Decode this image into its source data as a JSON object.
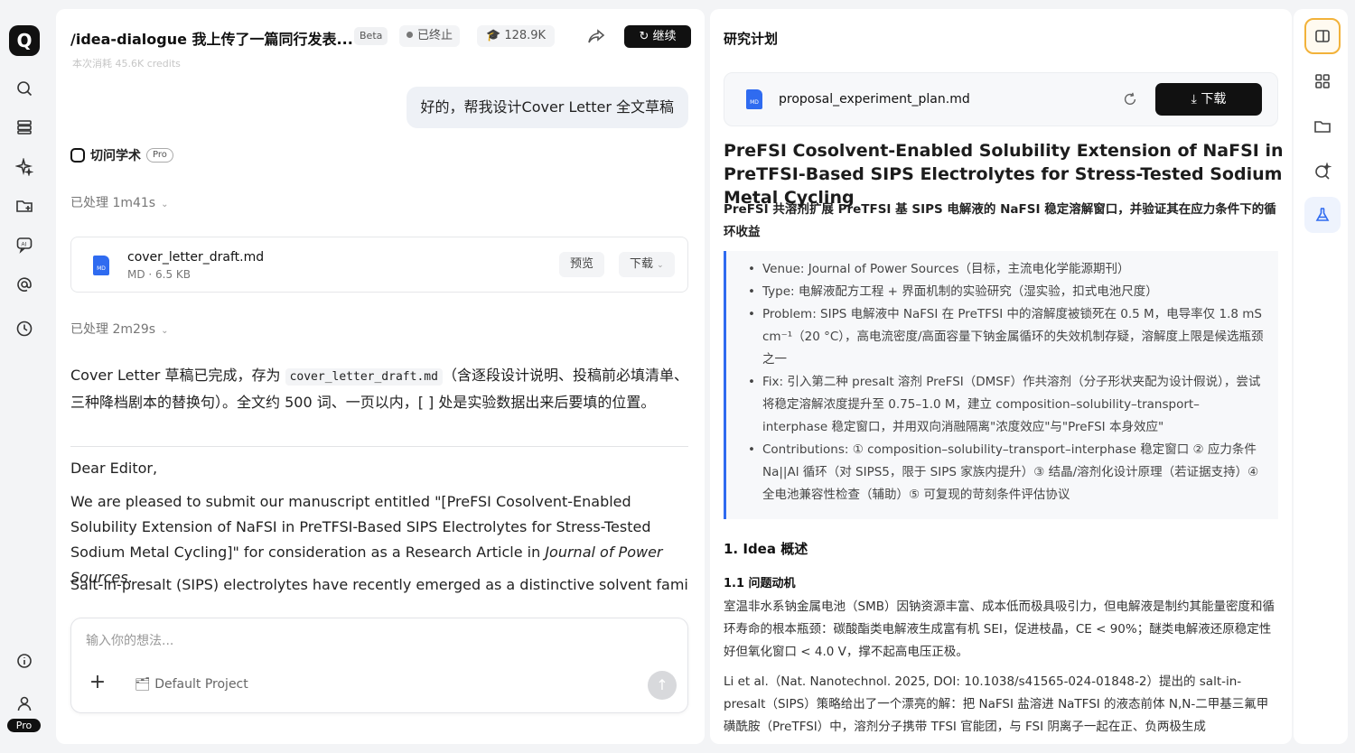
{
  "sidebar": {
    "logo_letter": "Q",
    "icons": [
      "search-icon",
      "list-icon",
      "sparkle-icon",
      "folder-add-icon",
      "ai-chat-icon",
      "at-icon",
      "clock-icon",
      "info-icon",
      "user-icon"
    ],
    "pro_label": "Pro"
  },
  "chat": {
    "title": "/idea-dialogue 我上传了一篇同行发表...",
    "beta": "Beta",
    "status": "已终止",
    "credits": "128.9K",
    "continue_label": "继续",
    "faded_line": "本次消耗 45.6K credits",
    "user_message": "好的，帮我设计Cover Letter 全文草稿",
    "brand_name": "切问学术",
    "brand_pro": "Pro",
    "processed_1": "已处理  1m41s",
    "processed_2": "已处理  2m29s",
    "file": {
      "name": "cover_letter_draft.md",
      "meta": "MD · 6.5 KB",
      "icon_label": "MD",
      "preview_label": "预览",
      "download_label": "下载"
    },
    "summary_pre": "Cover Letter 草稿已完成，存为 ",
    "summary_code": "cover_letter_draft.md",
    "summary_post": "（含逐段设计说明、投稿前必填清单、三种降档剧本的替换句）。全文约 500 词、一页以内，[ ] 处是实验数据出来后要填的位置。",
    "greeting": "Dear Editor,",
    "para_pre": "We are pleased to submit our manuscript entitled \"[PreFSI Cosolvent-Enabled Solubility Extension of NaFSI in PreTFSI-Based SIPS Electrolytes for Stress-Tested Sodium Metal Cycling]\" for consideration as a Research Article in ",
    "para_journal": "Journal of Power Sources",
    "para_post": ".",
    "para_2": "Salt-in-presalt (SIPS) electrolytes have recently emerged as a distinctive solvent family",
    "input_placeholder": "输入你的想法...",
    "project_label": "Default Project"
  },
  "doc": {
    "panel_title": "研究计划",
    "file_name": "proposal_experiment_plan.md",
    "file_icon_label": "MD",
    "download_label": "下载",
    "h1": "PreFSI Cosolvent-Enabled Solubility Extension of NaFSI in PreTFSI-Based SIPS Electrolytes for Stress-Tested Sodium Metal Cycling",
    "subtitle": "PreFSI 共溶剂扩展 PreTFSI 基 SIPS 电解液的 NaFSI 稳定溶解窗口，并验证其在应力条件下的循环收益",
    "bullets": [
      "Venue: Journal of Power Sources（目标，主流电化学能源期刊）",
      "Type: 电解液配方工程 + 界面机制的实验研究（湿实验，扣式电池尺度）",
      "Problem: SIPS 电解液中 NaFSI 在 PreTFSI 中的溶解度被锁死在 0.5 M，电导率仅 1.8 mS cm⁻¹（20 °C），高电流密度/高面容量下钠金属循环的失效机制存疑，溶解度上限是候选瓶颈之一",
      "Fix: 引入第二种 presalt 溶剂 PreFSI（DMSF）作共溶剂（分子形状夹配为设计假说），尝试将稳定溶解浓度提升至 0.75–1.0 M，建立 composition–solubility–transport–interphase 稳定窗口，并用双向消融隔离\"浓度效应\"与\"PreFSI 本身效应\"",
      "Contributions: ① composition–solubility–transport–interphase 稳定窗口 ② 应力条件 Na||Al 循环（对 SIPS5，限于 SIPS 家族内提升）③ 结晶/溶剂化设计原理（若证据支持）④ 全电池兼容性检查（辅助）⑤ 可复现的苛刻条件评估协议"
    ],
    "h2": "1. Idea 概述",
    "h3": "1.1 问题动机",
    "p1": "室温非水系钠金属电池（SMB）因钠资源丰富、成本低而极具吸引力，但电解液是制约其能量密度和循环寿命的根本瓶颈：碳酸酯类电解液生成富有机 SEI，促进枝晶，CE < 90%；醚类电解液还原稳定性好但氧化窗口 < 4.0 V，撑不起高电压正极。",
    "p2": "Li et al.（Nat. Nanotechnol. 2025, DOI: 10.1038/s41565-024-01848-2）提出的 salt-in-presalt（SIPS）策略给出了一个漂亮的解：把 NaFSI 盐溶进 NaTFSI 的液态前体 N,N-二甲基三氟甲磺酰胺（PreTFSI）中，溶剂分子携带 TFSI 官能团，与 FSI 阴离子一起在正、负两极生成"
  },
  "toolbar": {
    "icons": [
      "panel-icon",
      "apps-icon",
      "folder-icon",
      "ai-search-icon",
      "flask-icon"
    ]
  }
}
